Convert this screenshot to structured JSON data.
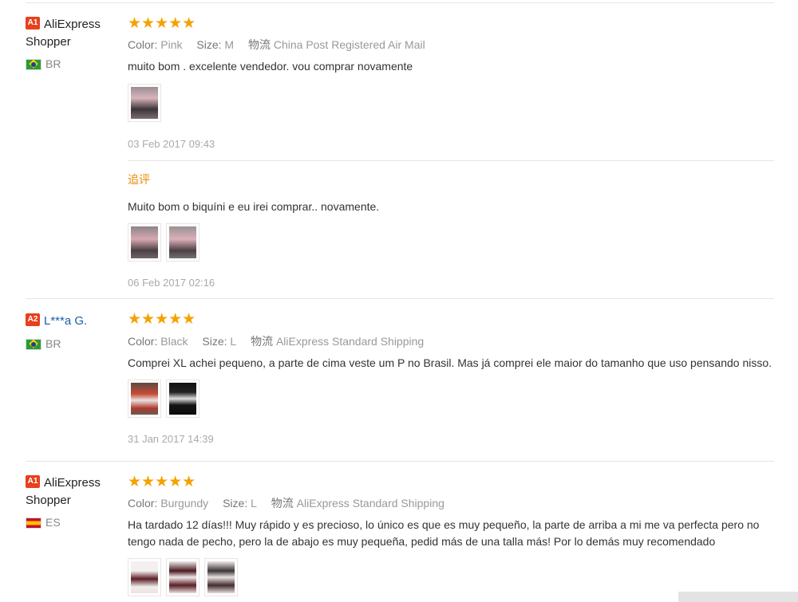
{
  "colors": {
    "star": "#f5a201",
    "level_badge": "#e8401d",
    "link": "#1a5fa8",
    "follow_label": "#e88a00"
  },
  "reviews": [
    {
      "level": "A1",
      "name": "AliExpress Shopper",
      "country_code": "BR",
      "flag": "brazil-flag",
      "stars": "★★★★★",
      "color_label": "Color:",
      "color": "Pink",
      "size_label": "Size:",
      "size": "M",
      "logistics_label": "物流",
      "shipping": "China Post Registered Air Mail",
      "text": "muito bom . excelente vendedor. vou comprar novamente",
      "date": "03 Feb 2017 09:43",
      "followup": {
        "label": "追评",
        "text": "Muito bom o biquíni e eu irei comprar.. novamente.",
        "date": "06 Feb 2017 02:16"
      }
    },
    {
      "level": "A2",
      "name": "L***a G.",
      "country_code": "BR",
      "flag": "brazil-flag",
      "stars": "★★★★★",
      "color_label": "Color:",
      "color": "Black",
      "size_label": "Size:",
      "size": "L",
      "logistics_label": "物流",
      "shipping": "AliExpress Standard Shipping",
      "text": "Comprei XL achei pequeno, a parte de cima veste um P no Brasil. Mas já comprei ele maior do tamanho que uso pensando nisso.",
      "date": "31 Jan 2017 14:39"
    },
    {
      "level": "A1",
      "name": "AliExpress Shopper",
      "country_code": "ES",
      "flag": "spain-flag",
      "stars": "★★★★★",
      "color_label": "Color:",
      "color": "Burgundy",
      "size_label": "Size:",
      "size": "L",
      "logistics_label": "物流",
      "shipping": "AliExpress Standard Shipping",
      "text_line1": "Ha tardado 12 días!!! Muy rápido y es precioso, lo único es que es muy pequeño, la parte de arriba a mi me va perfecta pero no",
      "text_line2": "tengo nada de pecho, pero la de abajo es muy pequeña, pedid más de una talla más! Por lo demás muy recomendado"
    }
  ]
}
